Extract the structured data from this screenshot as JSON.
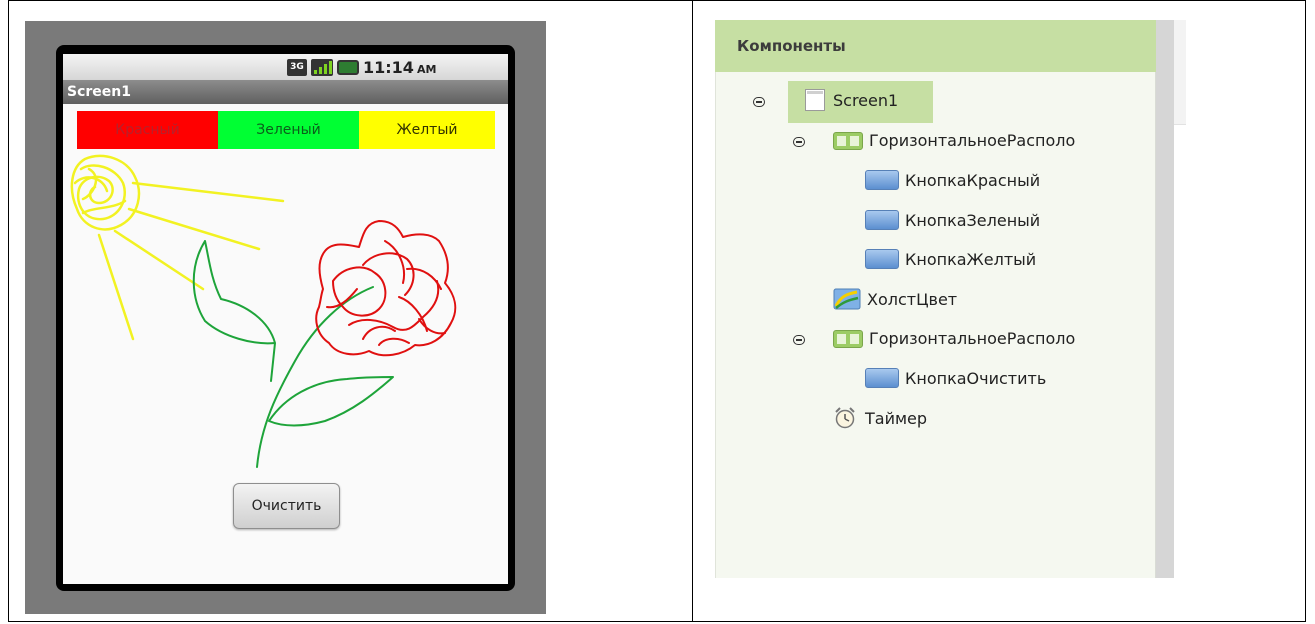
{
  "phone": {
    "status_time": "11:14",
    "status_ampm": "AM",
    "network_label": "3G",
    "screen_title": "Screen1",
    "color_buttons": [
      {
        "label": "Красный",
        "color": "#ff0000"
      },
      {
        "label": "Зеленый",
        "color": "#00ff33"
      },
      {
        "label": "Желтый",
        "color": "#ffff00"
      }
    ],
    "clear_button": "Очистить",
    "drawing_colors": {
      "sun": "#f2f222",
      "flower": "#e01010",
      "stem": "#1ea43a"
    }
  },
  "components": {
    "title": "Компоненты",
    "tree": [
      {
        "label": "Screen1",
        "icon": "screen-icon",
        "level": 0,
        "toggle": "collapse"
      },
      {
        "label": "ГоризонтальноеРасполо",
        "icon": "horizontal-arrangement-icon",
        "level": 1,
        "toggle": "collapse"
      },
      {
        "label": "КнопкаКрасный",
        "icon": "button-icon",
        "level": 2
      },
      {
        "label": "КнопкаЗеленый",
        "icon": "button-icon",
        "level": 2
      },
      {
        "label": "КнопкаЖелтый",
        "icon": "button-icon",
        "level": 2
      },
      {
        "label": "ХолстЦвет",
        "icon": "canvas-icon",
        "level": 1
      },
      {
        "label": "ГоризонтальноеРасполо",
        "icon": "horizontal-arrangement-icon",
        "level": 1,
        "toggle": "collapse"
      },
      {
        "label": "КнопкаОчистить",
        "icon": "button-icon",
        "level": 2
      },
      {
        "label": "Таймер",
        "icon": "timer-icon",
        "level": 1
      }
    ]
  }
}
